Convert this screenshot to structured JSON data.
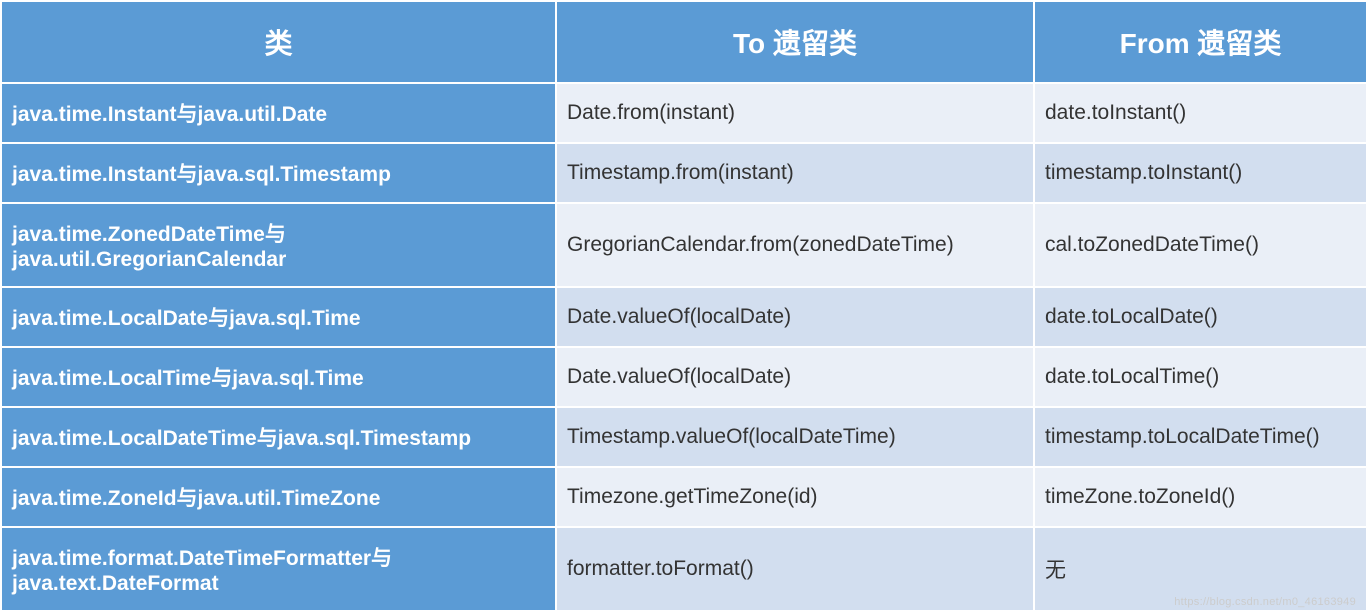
{
  "headers": [
    "类",
    "To 遗留类",
    "From 遗留类"
  ],
  "rows": [
    {
      "class": "java.time.Instant与java.util.Date",
      "to": "Date.from(instant)",
      "from": "date.toInstant()"
    },
    {
      "class": "java.time.Instant与java.sql.Timestamp",
      "to": "Timestamp.from(instant)",
      "from": "timestamp.toInstant()"
    },
    {
      "class": "java.time.ZonedDateTime与java.util.GregorianCalendar",
      "to": "GregorianCalendar.from(zonedDateTime)",
      "from": "cal.toZonedDateTime()"
    },
    {
      "class": "java.time.LocalDate与java.sql.Time",
      "to": "Date.valueOf(localDate)",
      "from": "date.toLocalDate()"
    },
    {
      "class": "java.time.LocalTime与java.sql.Time",
      "to": "Date.valueOf(localDate)",
      "from": "date.toLocalTime()"
    },
    {
      "class": "java.time.LocalDateTime与java.sql.Timestamp",
      "to": "Timestamp.valueOf(localDateTime)",
      "from": "timestamp.toLocalDateTime()"
    },
    {
      "class": "java.time.ZoneId与java.util.TimeZone",
      "to": "Timezone.getTimeZone(id)",
      "from": "timeZone.toZoneId()"
    },
    {
      "class": "java.time.format.DateTimeFormatter与java.text.DateFormat",
      "to": "formatter.toFormat()",
      "from": "无"
    }
  ],
  "watermark": "https://blog.csdn.net/m0_46163949"
}
